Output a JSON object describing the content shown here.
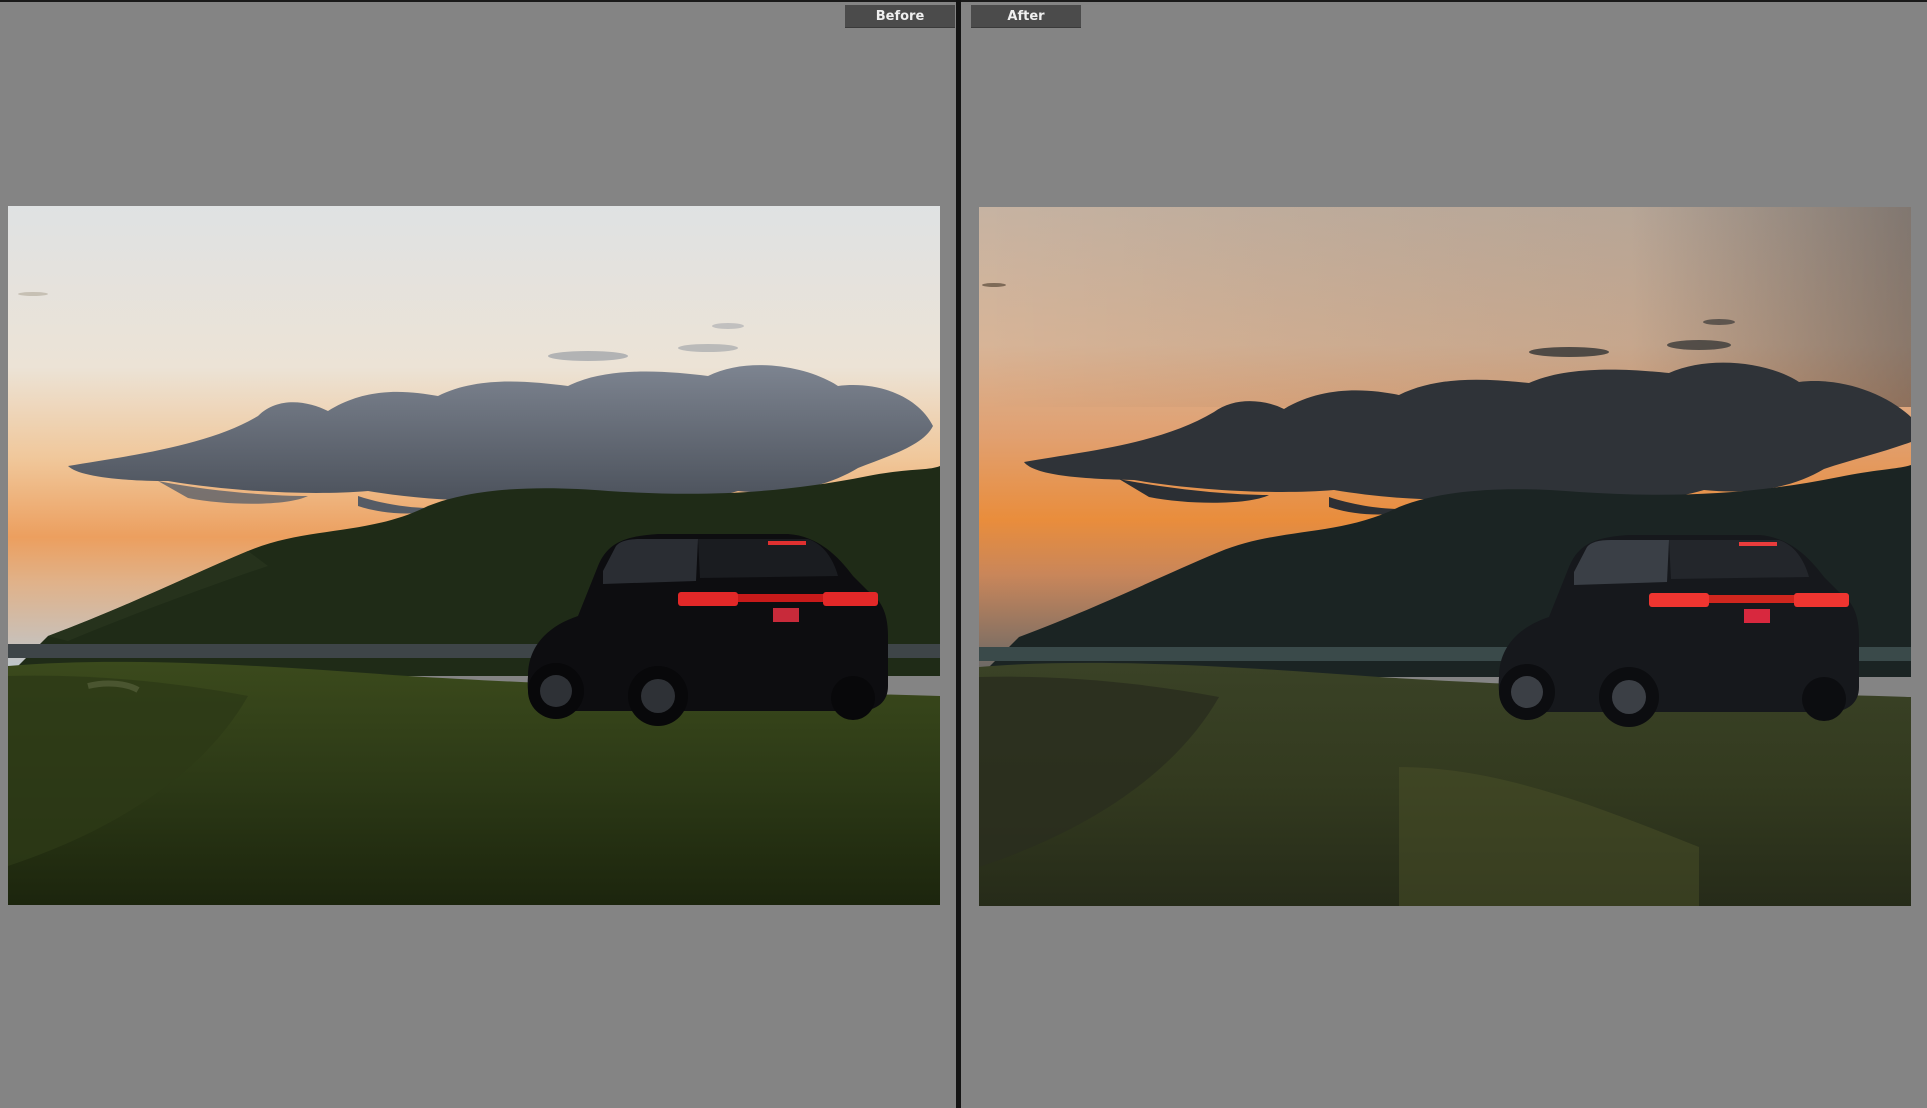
{
  "compare_view": {
    "before_label": "Before",
    "after_label": "After"
  },
  "colors": {
    "background": "#848484",
    "divider": "#141414",
    "label_bg": "#4b4b4b",
    "label_text": "#efefef"
  },
  "photos": {
    "before": {
      "icon": "car-sunset-photo",
      "variant": "original"
    },
    "after": {
      "icon": "car-sunset-photo",
      "variant": "edited"
    }
  }
}
